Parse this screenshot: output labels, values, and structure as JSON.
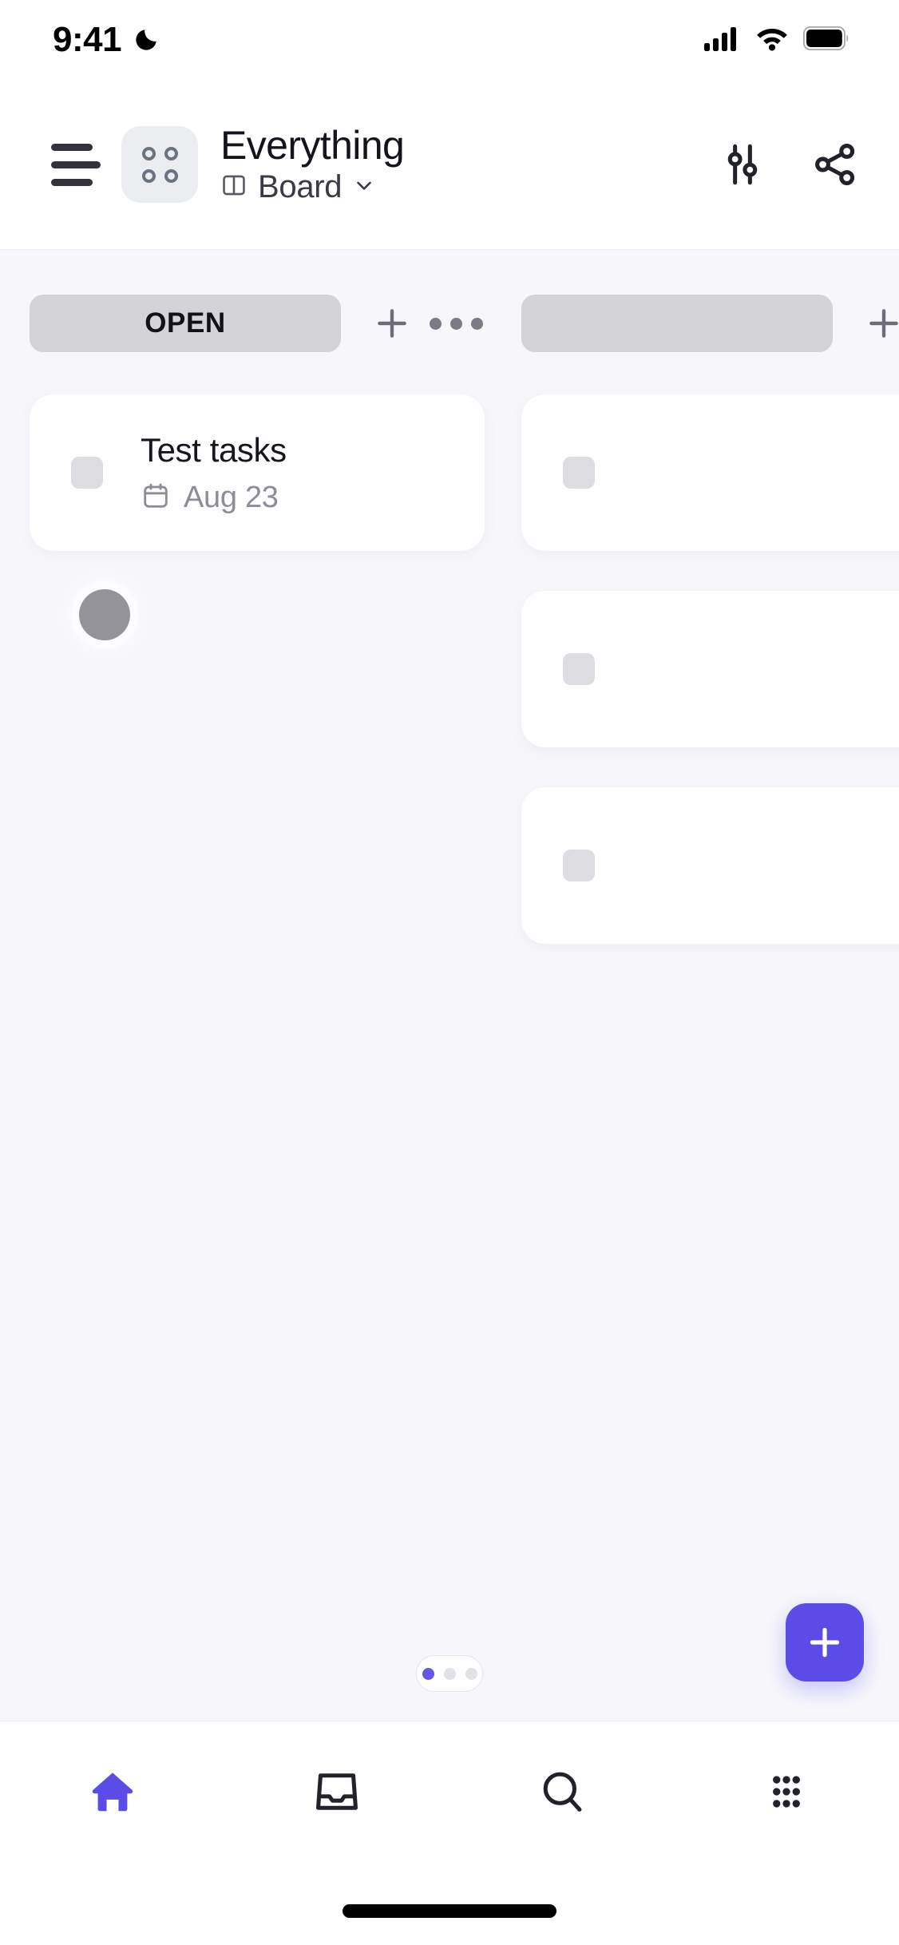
{
  "status_bar": {
    "time": "9:41",
    "dnd_icon": "moon-icon",
    "signal_icon": "cellular-signal-icon",
    "wifi_icon": "wifi-icon",
    "battery_icon": "battery-icon"
  },
  "header": {
    "menu_icon": "hamburger-menu-icon",
    "app_icon": "four-dots-app-icon",
    "title": "Everything",
    "view_icon": "board-columns-icon",
    "view_label": "Board",
    "view_chevron": "chevron-down-icon",
    "filter_icon": "sliders-filter-icon",
    "share_icon": "share-nodes-icon"
  },
  "board": {
    "columns": [
      {
        "label": "OPEN",
        "add_icon": "plus-icon",
        "more_icon": "ellipsis-icon",
        "cards": [
          {
            "title": "Test tasks",
            "date_icon": "calendar-icon",
            "date": "Aug 23"
          }
        ]
      },
      {
        "label": "",
        "add_icon": "plus-icon",
        "more_icon": "ellipsis-icon",
        "cards": [
          {
            "title": "",
            "date_icon": "",
            "date": ""
          },
          {
            "title": "",
            "date_icon": "",
            "date": ""
          },
          {
            "title": "",
            "date_icon": "",
            "date": ""
          }
        ]
      }
    ],
    "drag_handle": "drag-ghost-dot",
    "page_indicator": {
      "total": 3,
      "active": 1
    },
    "fab_icon": "plus-icon"
  },
  "bottom_nav": {
    "items": [
      {
        "icon": "home-icon",
        "active": true
      },
      {
        "icon": "inbox-icon",
        "active": false
      },
      {
        "icon": "search-icon",
        "active": false
      },
      {
        "icon": "grid-apps-icon",
        "active": false
      }
    ]
  },
  "colors": {
    "accent": "#5b4ce8",
    "board_bg": "#f7f7fb",
    "column_pill": "#d3d3d8",
    "card_bg": "#ffffff",
    "text_primary": "#14141c",
    "text_muted": "#8d8d99"
  }
}
